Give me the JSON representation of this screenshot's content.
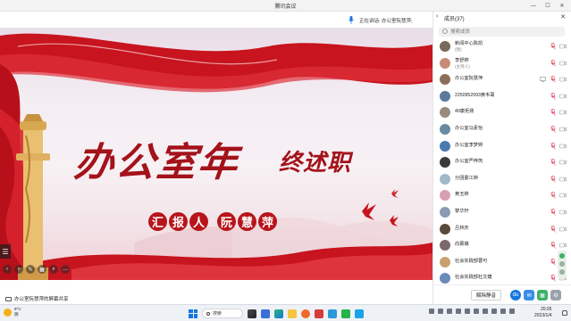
{
  "window": {
    "title": "腾讯会议"
  },
  "speaking": {
    "text": "正在讲话: 办公室阮慧萍;"
  },
  "slide": {
    "title_main": "办公室年",
    "title_sub": "终述职",
    "report_label": [
      "汇",
      "报",
      "人"
    ],
    "reporter_name": [
      "阮",
      "慧",
      "萍"
    ]
  },
  "share_status": {
    "text": "办公室阮慧萍的屏幕共享"
  },
  "panel": {
    "title": "成员(37)",
    "search_placeholder": "搜索成员",
    "members": [
      {
        "name": "新闻中心陈凯",
        "role": "(我)",
        "color": "#7a6a5a"
      },
      {
        "name": "李舒婷",
        "role": "(主持人)",
        "color": "#c98a7a"
      },
      {
        "name": "办公室阮慧萍",
        "role": "",
        "color": "#8b6e5a",
        "sharing": true
      },
      {
        "name": "2250952093黄韦蔼",
        "role": "",
        "color": "#5a7a9a"
      },
      {
        "name": "40康炬炀",
        "role": "",
        "color": "#9a8a7a"
      },
      {
        "name": "办公室马素怡",
        "role": "",
        "color": "#6a8aa0"
      },
      {
        "name": "办公室李梦婷",
        "role": "",
        "color": "#4a7ab0"
      },
      {
        "name": "办公室严梓芮",
        "role": "",
        "color": "#3a3a3a"
      },
      {
        "name": "分团委江婷",
        "role": "",
        "color": "#a0b8c8"
      },
      {
        "name": "黄玉婷",
        "role": "",
        "color": "#d8a0b0"
      },
      {
        "name": "黎华轩",
        "role": "",
        "color": "#8a9ab0"
      },
      {
        "name": "吕林庆",
        "role": "",
        "color": "#5a4a3a"
      },
      {
        "name": "向慕璐",
        "role": "",
        "color": "#7a6a6a"
      },
      {
        "name": "社会实践部曹可",
        "role": "",
        "color": "#c8a070"
      },
      {
        "name": "社会实践部杜文婕",
        "role": "",
        "color": "#6a8aba"
      }
    ],
    "unmute_all": "解除静音"
  },
  "taskbar": {
    "weather_temp": "9°C",
    "weather_desc": "阴",
    "search_label": "搜索",
    "time": "20:26",
    "date": "2023/1/4"
  },
  "colors": {
    "accent": "#1677e0",
    "slide_red": "#a4121a",
    "mic_muted": "#e0445a"
  }
}
